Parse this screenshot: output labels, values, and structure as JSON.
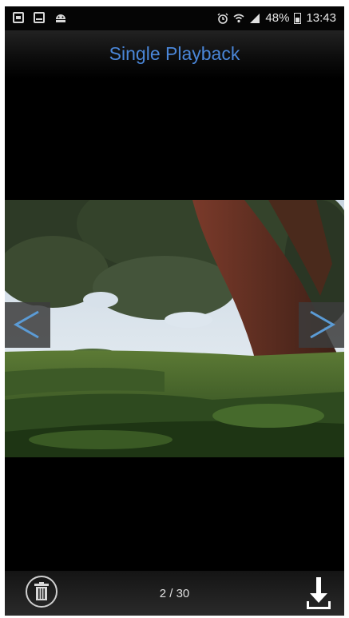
{
  "status_bar": {
    "left_icons": [
      "gallery-icon",
      "mail-icon",
      "android-icon"
    ],
    "right_icons": [
      "alarm-icon",
      "wifi-icon",
      "signal-icon",
      "battery-icon"
    ],
    "battery": "48%",
    "time": "13:43"
  },
  "header": {
    "title": "Single Playback"
  },
  "viewer": {
    "prev_icon": "chevron-left-icon",
    "next_icon": "chevron-right-icon"
  },
  "bottom_bar": {
    "delete_icon": "trash-icon",
    "page_counter": "2 / 30",
    "download_icon": "download-icon"
  },
  "colors": {
    "title": "#4a86d8",
    "arrow": "#5b9bd5",
    "background": "#000000"
  }
}
